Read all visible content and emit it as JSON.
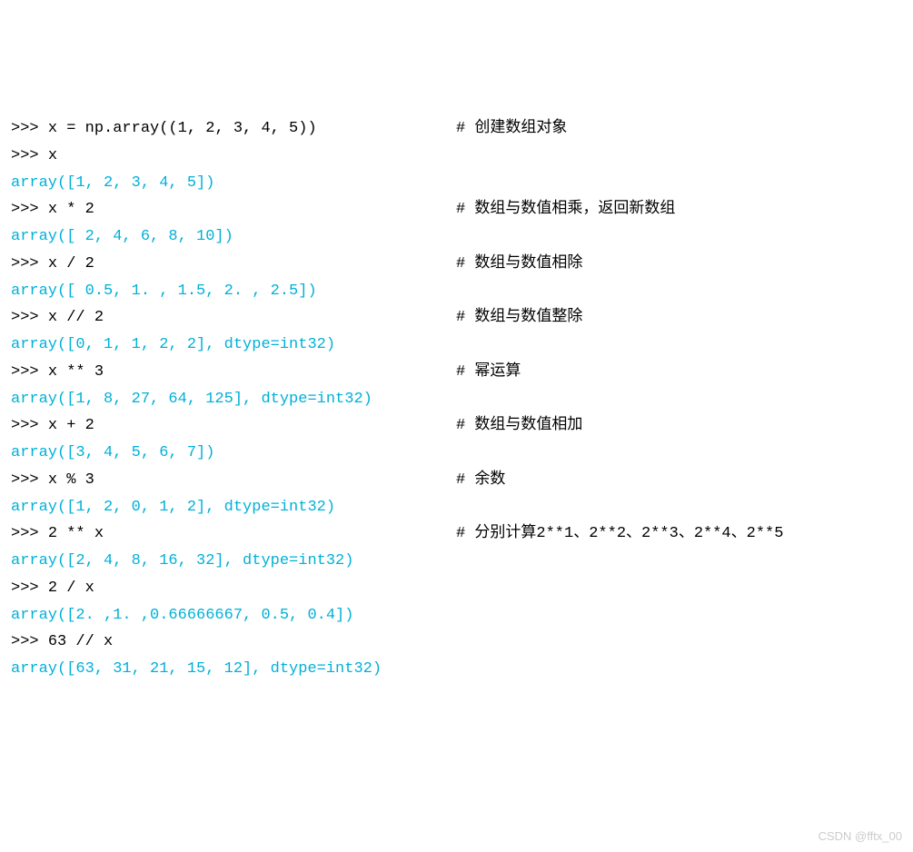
{
  "lines": [
    {
      "type": "input",
      "prompt": ">>> ",
      "code": "x = np.array((1, 2, 3, 4, 5))",
      "comment": "# 创建数组对象"
    },
    {
      "type": "input",
      "prompt": ">>> ",
      "code": "x",
      "comment": ""
    },
    {
      "type": "output",
      "text": "array([1, 2, 3, 4, 5])"
    },
    {
      "type": "input",
      "prompt": ">>> ",
      "code": "x * 2",
      "comment": "# 数组与数值相乘，返回新数组"
    },
    {
      "type": "output",
      "text": "array([ 2, 4, 6, 8, 10])"
    },
    {
      "type": "input",
      "prompt": ">>> ",
      "code": "x / 2",
      "comment": "# 数组与数值相除"
    },
    {
      "type": "output",
      "text": "array([ 0.5, 1. , 1.5, 2. , 2.5])"
    },
    {
      "type": "input",
      "prompt": ">>> ",
      "code": "x // 2",
      "comment": "# 数组与数值整除"
    },
    {
      "type": "output",
      "text": "array([0, 1, 1, 2, 2], dtype=int32)"
    },
    {
      "type": "input",
      "prompt": ">>> ",
      "code": "x ** 3",
      "comment": "# 幂运算"
    },
    {
      "type": "output",
      "text": "array([1, 8, 27, 64, 125], dtype=int32)"
    },
    {
      "type": "input",
      "prompt": ">>> ",
      "code": "x + 2",
      "comment": "# 数组与数值相加"
    },
    {
      "type": "output",
      "text": "array([3, 4, 5, 6, 7])"
    },
    {
      "type": "input",
      "prompt": ">>> ",
      "code": "x % 3",
      "comment": "# 余数"
    },
    {
      "type": "output",
      "text": "array([1, 2, 0, 1, 2], dtype=int32)"
    },
    {
      "type": "input",
      "prompt": ">>> ",
      "code": "2 ** x",
      "comment": "# 分别计算2**1、2**2、2**3、2**4、2**5"
    },
    {
      "type": "output",
      "text": "array([2, 4, 8, 16, 32], dtype=int32)"
    },
    {
      "type": "input",
      "prompt": ">>> ",
      "code": "2 / x",
      "comment": ""
    },
    {
      "type": "output",
      "text": "array([2. ,1. ,0.66666667, 0.5, 0.4])"
    },
    {
      "type": "input",
      "prompt": ">>> ",
      "code": "63 // x",
      "comment": ""
    },
    {
      "type": "output",
      "text": "array([63, 31, 21, 15, 12], dtype=int32)"
    }
  ],
  "watermark": "CSDN @fftx_00"
}
